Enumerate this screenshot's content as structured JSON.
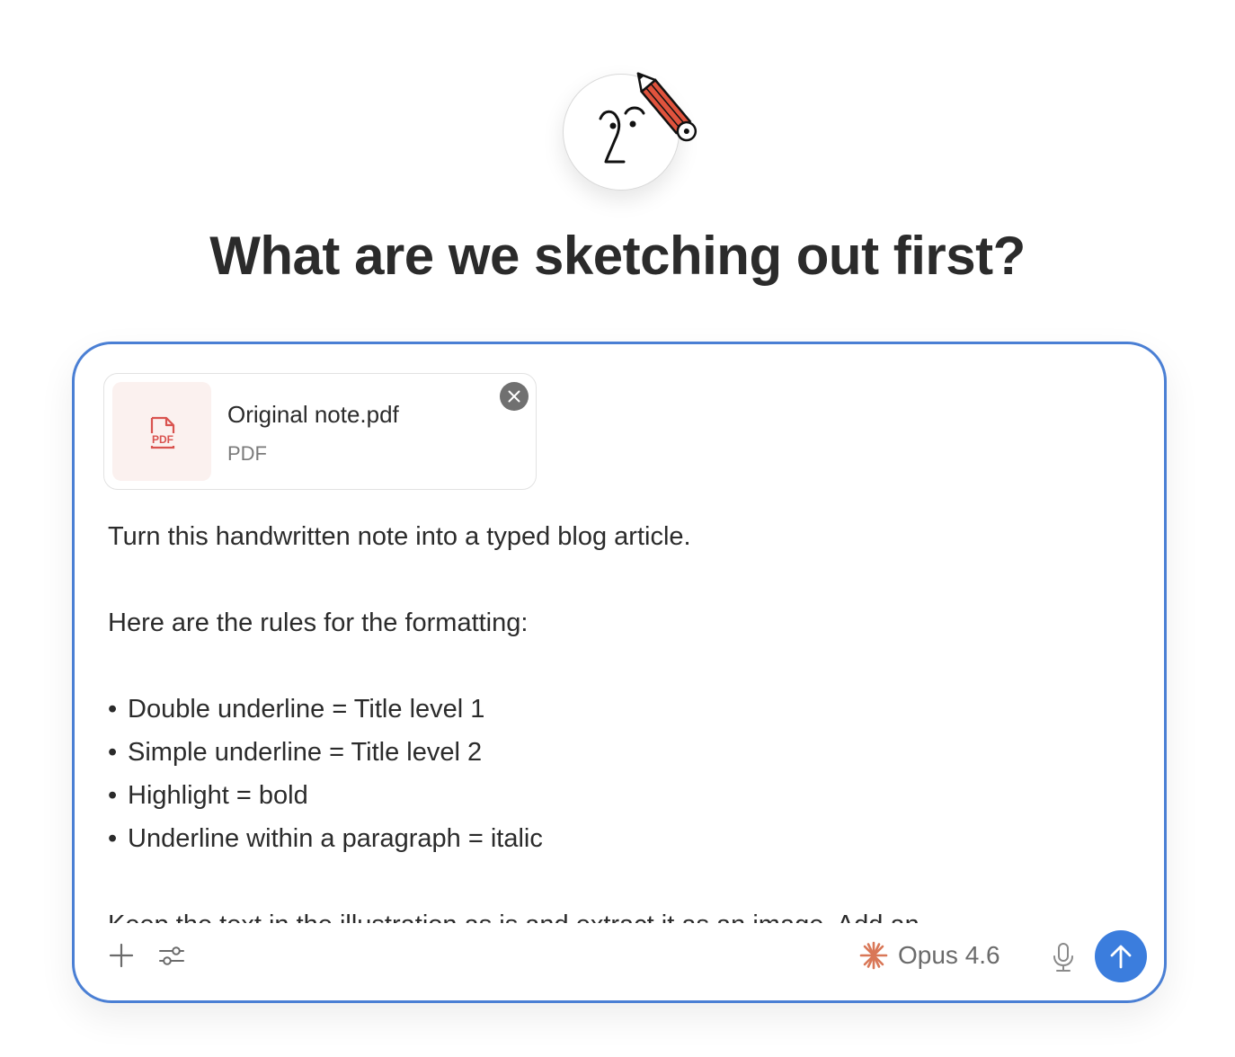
{
  "heading": "What are we sketching out first?",
  "attachment": {
    "file_name": "Original note.pdf",
    "file_type": "PDF",
    "thumb_label": "PDF",
    "icon": "pdf-file-icon"
  },
  "prompt": {
    "line1": "Turn this handwritten note into a typed blog article.",
    "line2": "Here are the rules for the formatting:",
    "bullet_char": "•",
    "bullets": [
      "Double underline = Title level 1",
      "Simple underline = Title level 2",
      "Highlight = bold",
      "Underline within a paragraph = italic"
    ],
    "line_cut": "Keep the text in the illustration as is and extract it as an image. Add an"
  },
  "toolbar": {
    "add_icon": "plus-icon",
    "settings_icon": "sliders-icon",
    "model_icon": "sparkle-icon",
    "model_label": "Opus 4.6",
    "mic_icon": "microphone-icon",
    "send_icon": "arrow-up-icon"
  },
  "colors": {
    "composer_border": "#4a7fd4",
    "send_button": "#3b7ddd",
    "sparkle": "#d97757",
    "pencil": "#e0533d",
    "pdf_icon": "#d9534f"
  }
}
